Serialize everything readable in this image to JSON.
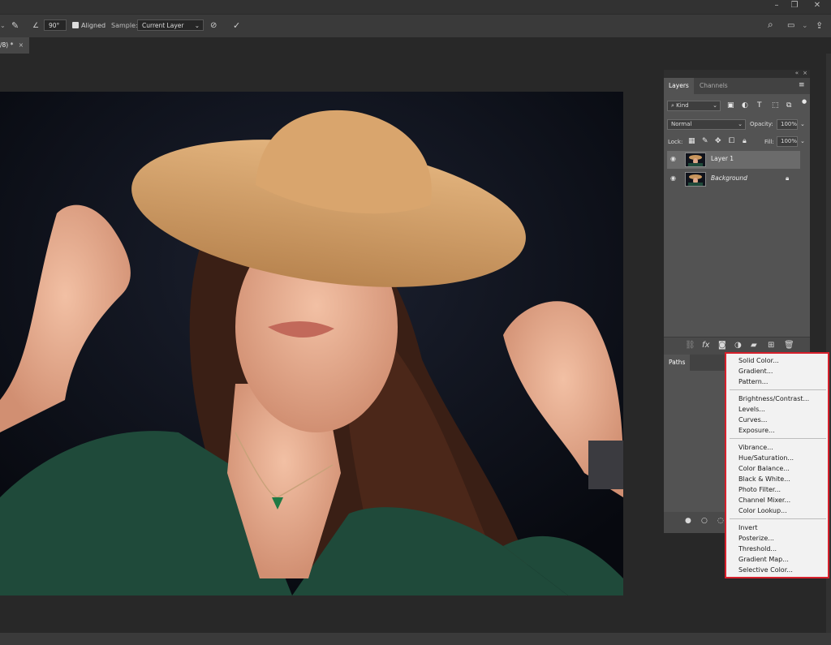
{
  "options_bar": {
    "angle_value": "90°",
    "aligned_label": "Aligned",
    "sample_label": "Sample:",
    "sample_value": "Current Layer"
  },
  "document_tab": {
    "label": "/8) *"
  },
  "layers_panel": {
    "tabs": [
      {
        "label": "Layers"
      },
      {
        "label": "Channels"
      }
    ],
    "filter_kind": "Kind",
    "blend_mode": "Normal",
    "opacity_label": "Opacity:",
    "opacity_value": "100%",
    "lock_label": "Lock:",
    "fill_label": "Fill:",
    "fill_value": "100%",
    "layers": [
      {
        "name": "Layer 1"
      },
      {
        "name": "Background"
      }
    ]
  },
  "paths_panel": {
    "tab_label": "Paths"
  },
  "adjustment_menu": {
    "groups": [
      [
        "Solid Color...",
        "Gradient...",
        "Pattern..."
      ],
      [
        "Brightness/Contrast...",
        "Levels...",
        "Curves...",
        "Exposure..."
      ],
      [
        "Vibrance...",
        "Hue/Saturation...",
        "Color Balance...",
        "Black & White...",
        "Photo Filter...",
        "Channel Mixer...",
        "Color Lookup..."
      ],
      [
        "Invert",
        "Posterize...",
        "Threshold...",
        "Gradient Map...",
        "Selective Color..."
      ]
    ]
  },
  "colors": {
    "menu_border": "#d7202c",
    "panel_bg": "#535353",
    "app_bg": "#282828"
  }
}
